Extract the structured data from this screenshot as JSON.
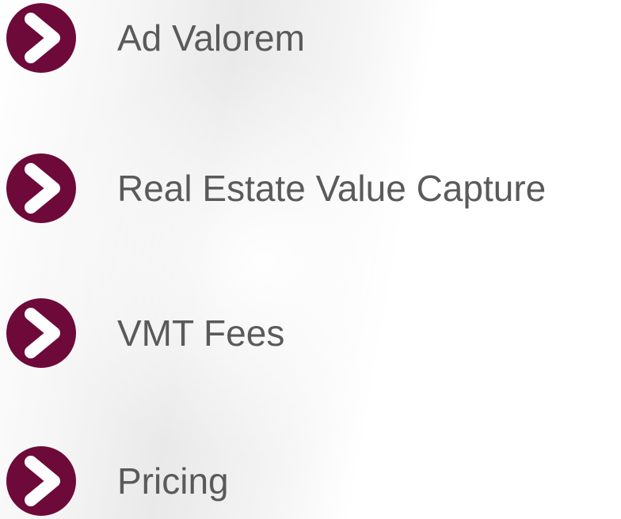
{
  "colors": {
    "bullet_fill": "#6e0a3a",
    "bullet_chevron": "#ffffff",
    "label_text": "#5a5a5a"
  },
  "bullet_icon": "chevron-right-icon",
  "items": [
    {
      "label": "Ad Valorem"
    },
    {
      "label": "Real Estate Value Capture"
    },
    {
      "label": "VMT Fees"
    },
    {
      "label": "Pricing"
    }
  ]
}
